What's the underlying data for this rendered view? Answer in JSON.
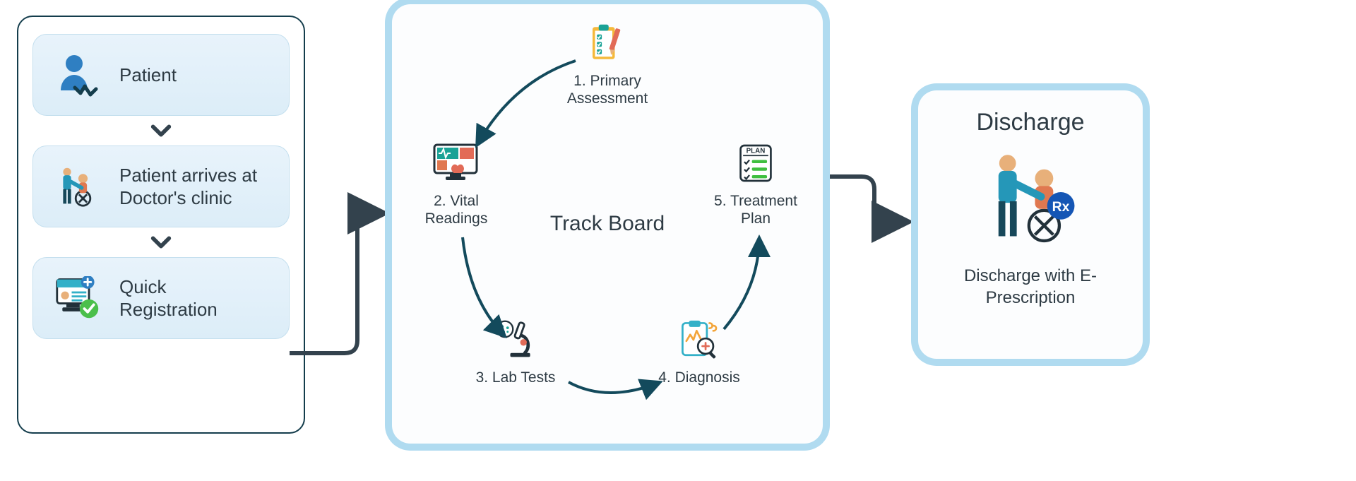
{
  "left": {
    "cards": [
      {
        "label": "Patient"
      },
      {
        "label": "Patient arrives at Doctor's clinic"
      },
      {
        "label": "Quick Registration"
      }
    ]
  },
  "mid": {
    "title": "Track Board",
    "nodes": [
      {
        "label": "1. Primary Assessment"
      },
      {
        "label": "2. Vital Readings"
      },
      {
        "label": "3. Lab Tests"
      },
      {
        "label": "4. Diagnosis"
      },
      {
        "label": "5. Treatment Plan"
      }
    ]
  },
  "right": {
    "title": "Discharge",
    "subtitle": "Discharge with E- Prescription"
  },
  "colors": {
    "frame": "#143d4c",
    "accent": "#b0dbf0",
    "text": "#2e3b44",
    "cardbg": "#e4f1fa"
  }
}
